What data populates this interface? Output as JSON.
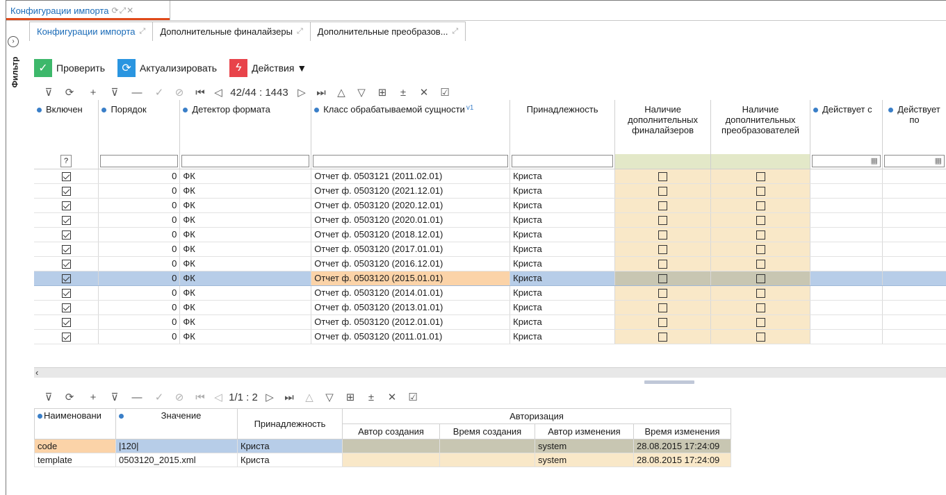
{
  "window_tab": {
    "title": "Конфигурации импорта",
    "icons": "⟳⤢✕"
  },
  "side": {
    "filter_label": "Фильтр",
    "expand_icon": "›"
  },
  "tabs": [
    {
      "label": "Конфигурации импорта"
    },
    {
      "label": "Дополнительные финалайзеры"
    },
    {
      "label": "Дополнительные преобразов..."
    }
  ],
  "actions": {
    "check": "Проверить",
    "refresh": "Актуализировать",
    "actions": "Действия ▼"
  },
  "toolbar_main": {
    "position": "42/44 : 1443"
  },
  "toolbar_bottom": {
    "position": "1/1 : 2"
  },
  "main_table": {
    "headers": {
      "enabled": "Включен",
      "order": "Порядок",
      "detector": "Детектор формата",
      "entity_class": "Класс обрабатываемой сущности",
      "sort_mark": "v1",
      "affiliation": "Принадлежность",
      "finalizers": "Наличие дополнительных финалайзеров",
      "transformers": "Наличие дополнительных преобразователей",
      "valid_from": "Действует с",
      "valid_to": "Действует по"
    },
    "filter_q": "?",
    "rows": [
      {
        "order": "0",
        "detector": "ФК",
        "entity": "Отчет ф. 0503121 (2011.02.01)",
        "aff": "Криста"
      },
      {
        "order": "0",
        "detector": "ФК",
        "entity": "Отчет ф. 0503120 (2021.12.01)",
        "aff": "Криста"
      },
      {
        "order": "0",
        "detector": "ФК",
        "entity": "Отчет ф. 0503120 (2020.12.01)",
        "aff": "Криста"
      },
      {
        "order": "0",
        "detector": "ФК",
        "entity": "Отчет ф. 0503120 (2020.01.01)",
        "aff": "Криста"
      },
      {
        "order": "0",
        "detector": "ФК",
        "entity": "Отчет ф. 0503120 (2018.12.01)",
        "aff": "Криста"
      },
      {
        "order": "0",
        "detector": "ФК",
        "entity": "Отчет ф. 0503120 (2017.01.01)",
        "aff": "Криста"
      },
      {
        "order": "0",
        "detector": "ФК",
        "entity": "Отчет ф. 0503120 (2016.12.01)",
        "aff": "Криста"
      },
      {
        "order": "0",
        "detector": "ФК",
        "entity": "Отчет ф. 0503120 (2015.01.01)",
        "aff": "Криста"
      },
      {
        "order": "0",
        "detector": "ФК",
        "entity": "Отчет ф. 0503120 (2014.01.01)",
        "aff": "Криста"
      },
      {
        "order": "0",
        "detector": "ФК",
        "entity": "Отчет ф. 0503120 (2013.01.01)",
        "aff": "Криста"
      },
      {
        "order": "0",
        "detector": "ФК",
        "entity": "Отчет ф. 0503120 (2012.01.01)",
        "aff": "Криста"
      },
      {
        "order": "0",
        "detector": "ФК",
        "entity": "Отчет ф. 0503120 (2011.01.01)",
        "aff": "Криста"
      }
    ]
  },
  "param_table": {
    "headers": {
      "name": "Наименовани",
      "value": "Значение",
      "aff": "Принадлежность",
      "auth": "Авторизация",
      "created_by": "Автор создания",
      "created_at": "Время создания",
      "changed_by": "Автор изменения",
      "changed_at": "Время изменения"
    },
    "rows": [
      {
        "name": "code",
        "value": "|120|",
        "aff": "Криста",
        "created_by": "",
        "created_at": "",
        "changed_by": "system",
        "changed_at": "28.08.2015 17:24:09"
      },
      {
        "name": "template",
        "value": "0503120_2015.xml",
        "aff": "Криста",
        "created_by": "",
        "created_at": "",
        "changed_by": "system",
        "changed_at": "28.08.2015 17:24:09"
      }
    ]
  },
  "colors": {
    "accent": "#1a6bb8",
    "tab_underline": "#e04a1a",
    "selection": "#b7cde8",
    "tan": "#f9e8c8"
  }
}
